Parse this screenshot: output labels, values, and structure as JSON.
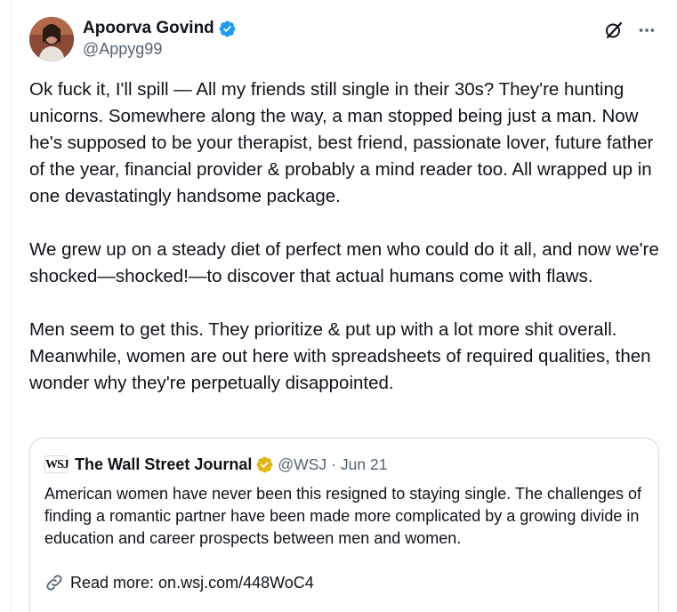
{
  "author": {
    "display_name": "Apoorva Govind",
    "handle": "@Appyg99"
  },
  "tweet": {
    "paragraphs": [
      "Ok fuck it, I'll spill — All my friends still single in their 30s? They're hunting unicorns. Somewhere along the way, a man stopped being just a man. Now he's supposed to be your therapist, best friend, passionate lover, future father of the year, financial provider & probably a mind reader too. All wrapped up in one devastatingly handsome package.",
      "We grew up on a steady diet of perfect men who could do it all, and now we're shocked—shocked!—to discover that actual humans come with flaws.",
      "Men seem to get this. They prioritize & put up with a lot more shit overall. Meanwhile, women are out here with spreadsheets of required qualities, then wonder why they're perpetually disappointed."
    ]
  },
  "quote": {
    "logo_text": "WSJ",
    "name": "The Wall Street Journal",
    "handle": "@WSJ",
    "separator": "·",
    "date": "Jun 21",
    "text": "American women have never been this resigned to staying single. The challenges of finding a romantic partner have been made more complicated by a growing divide in education and career prospects between men and women.",
    "link_text": "Read more: on.wsj.com/448WoC4"
  },
  "icons": {
    "verified": "verified-badge-icon",
    "gold": "gold-verified-badge-icon",
    "grok": "grok-icon",
    "more": "more-options-icon",
    "link": "link-icon"
  },
  "colors": {
    "verified_blue": "#1d9bf0",
    "gold": "#e2b719",
    "secondary_text": "#536471",
    "border": "#cfd9de"
  }
}
